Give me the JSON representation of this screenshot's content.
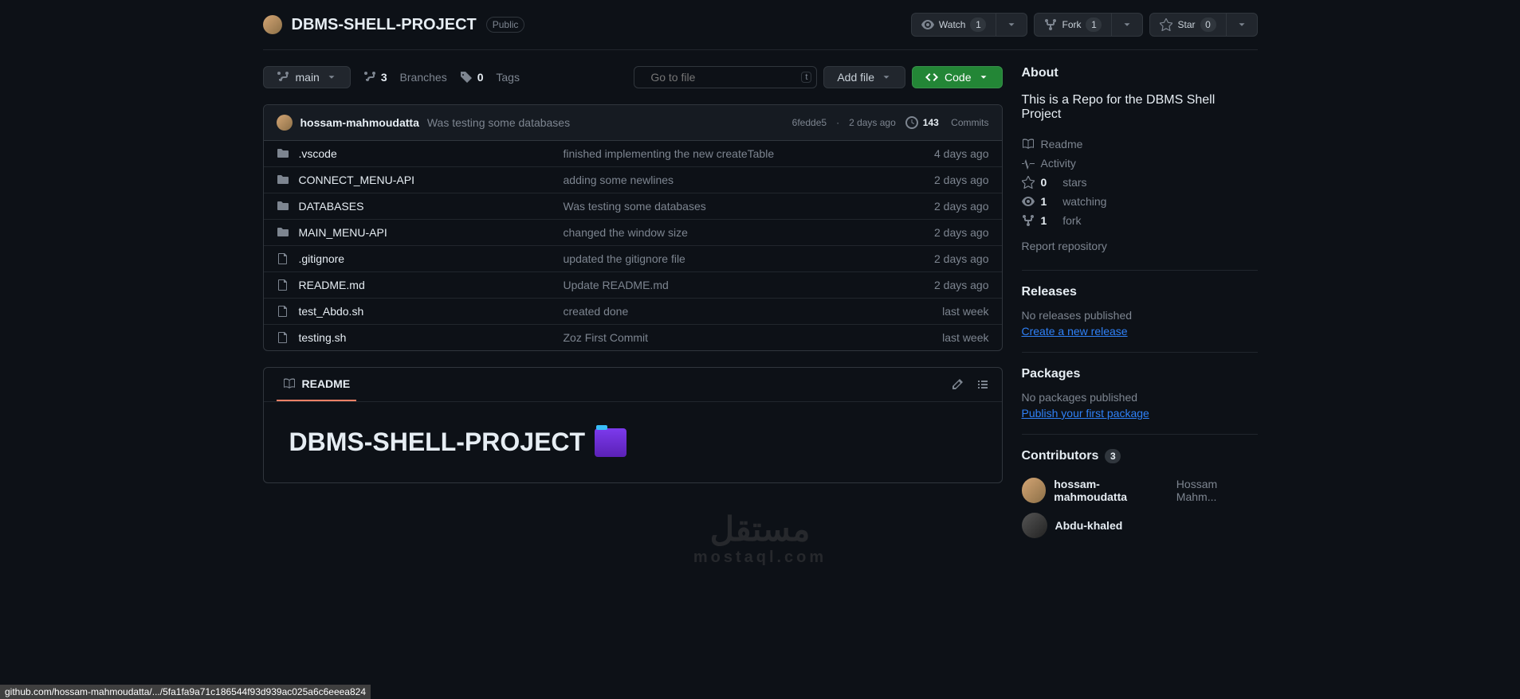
{
  "header": {
    "repo_name": "DBMS-SHELL-PROJECT",
    "visibility": "Public",
    "watch_label": "Watch",
    "watch_count": "1",
    "fork_label": "Fork",
    "fork_count": "1",
    "star_label": "Star",
    "star_count": "0"
  },
  "toolbar": {
    "branch": "main",
    "branches_count": "3",
    "branches_label": "Branches",
    "tags_count": "0",
    "tags_label": "Tags",
    "search_placeholder": "Go to file",
    "search_kbd": "t",
    "add_file": "Add file",
    "code": "Code"
  },
  "commit": {
    "author": "hossam-mahmoudatta",
    "message": "Was testing some databases",
    "sha": "6fedde5",
    "time": "2 days ago",
    "commits_count": "143",
    "commits_label": "Commits"
  },
  "files": [
    {
      "type": "dir",
      "name": ".vscode",
      "msg": "finished implementing the new createTable",
      "date": "4 days ago"
    },
    {
      "type": "dir",
      "name": "CONNECT_MENU-API",
      "msg": "adding some newlines",
      "date": "2 days ago"
    },
    {
      "type": "dir",
      "name": "DATABASES",
      "msg": "Was testing some databases",
      "date": "2 days ago"
    },
    {
      "type": "dir",
      "name": "MAIN_MENU-API",
      "msg": "changed the window size",
      "date": "2 days ago"
    },
    {
      "type": "file",
      "name": ".gitignore",
      "msg": "updated the gitignore file",
      "date": "2 days ago"
    },
    {
      "type": "file",
      "name": "README.md",
      "msg": "Update README.md",
      "date": "2 days ago"
    },
    {
      "type": "file",
      "name": "test_Abdo.sh",
      "msg": "created done",
      "date": "last week"
    },
    {
      "type": "file",
      "name": "testing.sh",
      "msg": "Zoz First Commit",
      "date": "last week"
    }
  ],
  "readme": {
    "tab": "README",
    "title": "DBMS-SHELL-PROJECT"
  },
  "about": {
    "heading": "About",
    "description": "This is a Repo for the DBMS Shell Project",
    "readme": "Readme",
    "activity": "Activity",
    "stars_count": "0",
    "stars_label": "stars",
    "watching_count": "1",
    "watching_label": "watching",
    "forks_count": "1",
    "forks_label": "fork",
    "report": "Report repository"
  },
  "releases": {
    "heading": "Releases",
    "none": "No releases published",
    "link": "Create a new release"
  },
  "packages": {
    "heading": "Packages",
    "none": "No packages published",
    "link": "Publish your first package"
  },
  "contributors": {
    "heading": "Contributors",
    "count": "3",
    "list": [
      {
        "login": "hossam-mahmoudatta",
        "name": "Hossam Mahm..."
      },
      {
        "login": "Abdu-khaled",
        "name": ""
      }
    ]
  },
  "statusbar": "github.com/hossam-mahmoudatta/.../5fa1fa9a71c186544f93d939ac025a6c6eeea824",
  "watermark": {
    "main": "مستقل",
    "sub": "mostaql.com"
  }
}
